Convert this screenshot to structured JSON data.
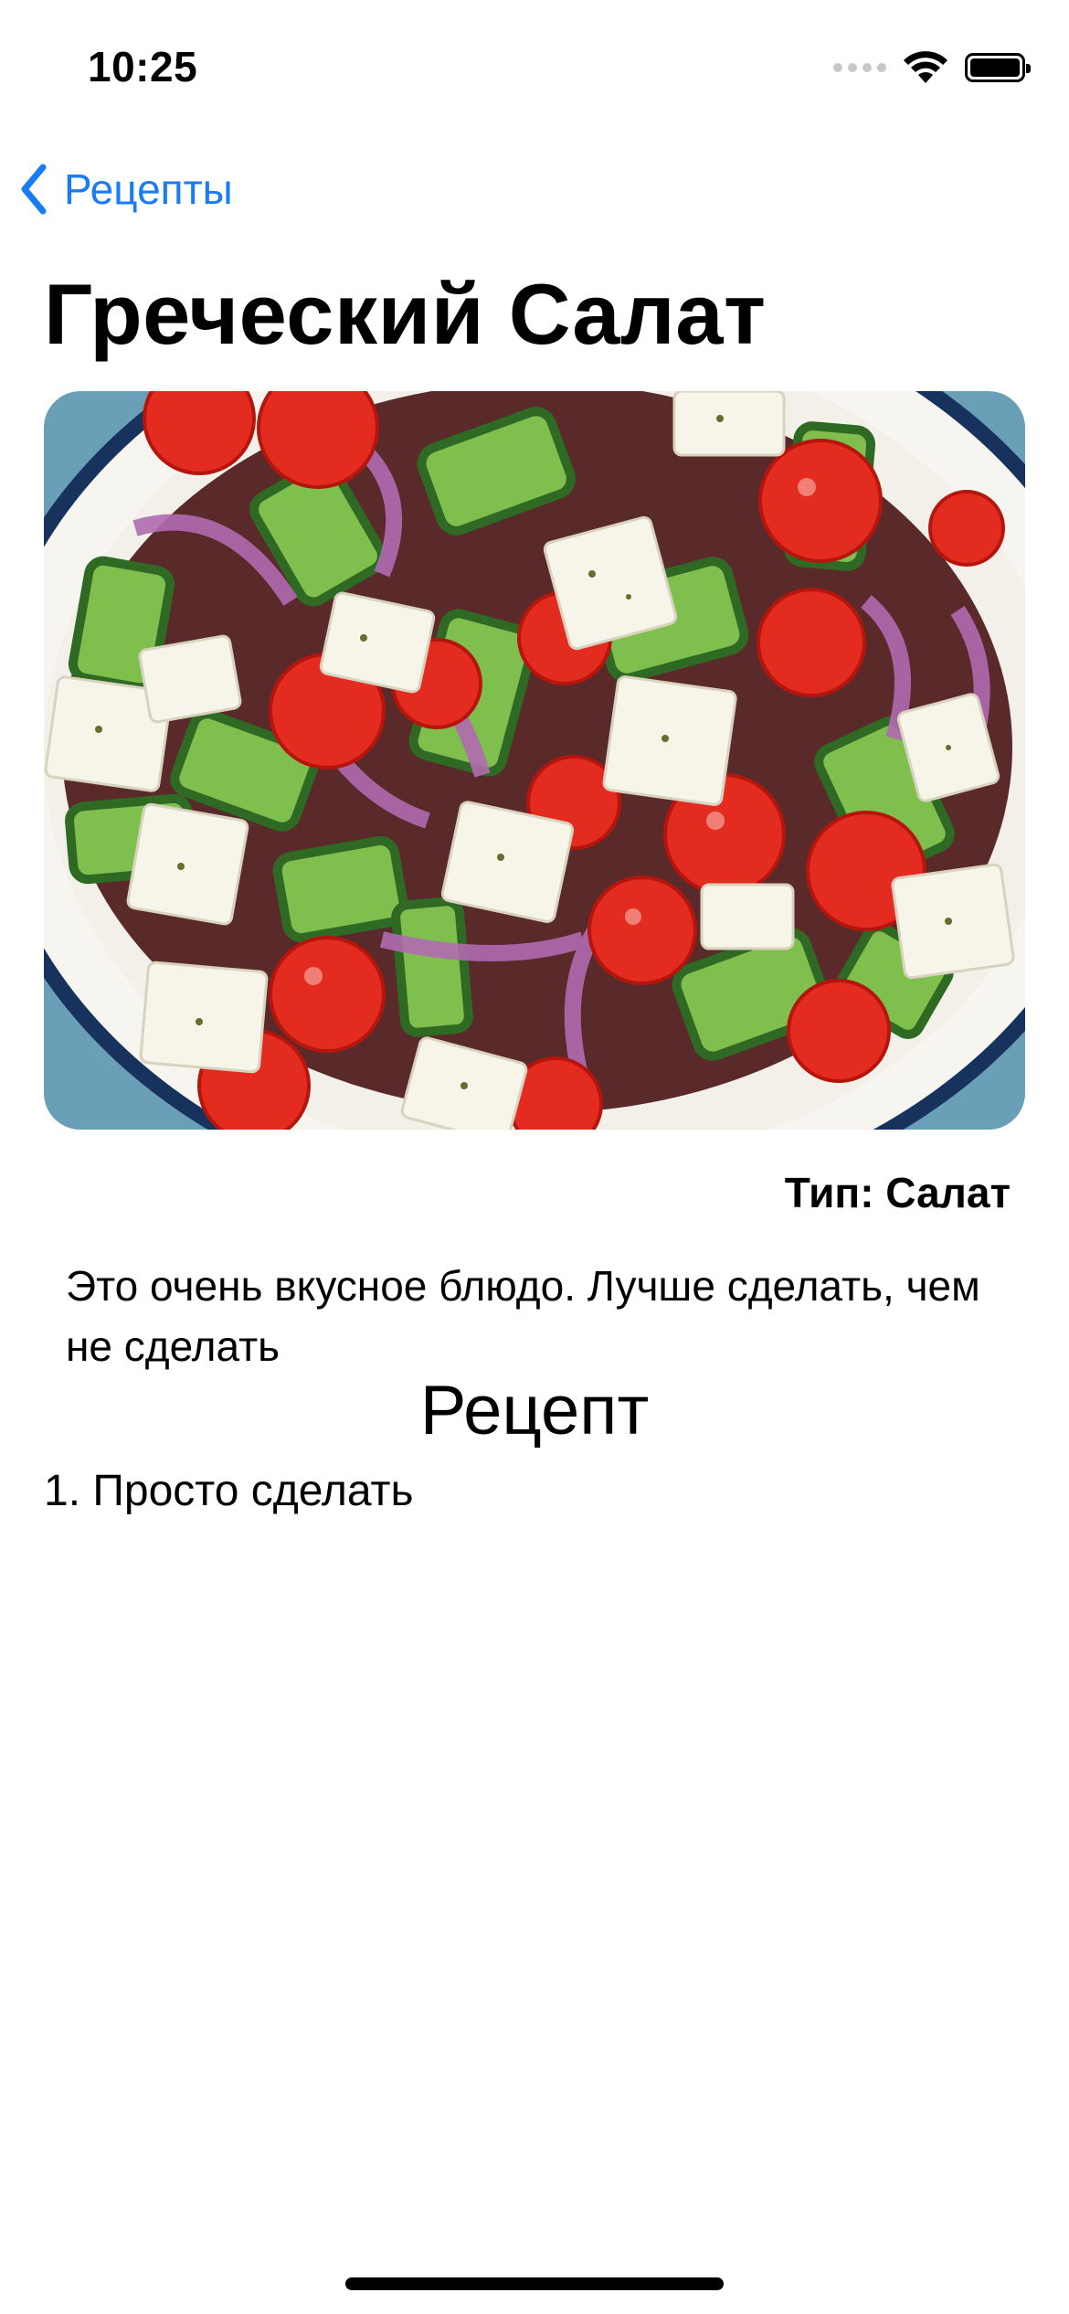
{
  "status_bar": {
    "time": "10:25",
    "battery_level": 1.0
  },
  "nav": {
    "back_label": "Рецепты"
  },
  "recipe": {
    "title": "Греческий Салат",
    "image_alt": "Греческий Салат",
    "type_line": "Тип: Салат",
    "description": "Это очень вкусное блюдо. Лучше сделать, чем не сделать",
    "section_title": "Рецепт",
    "steps": [
      "1. Просто сделать"
    ]
  },
  "colors": {
    "accent": "#1a7cf5"
  }
}
